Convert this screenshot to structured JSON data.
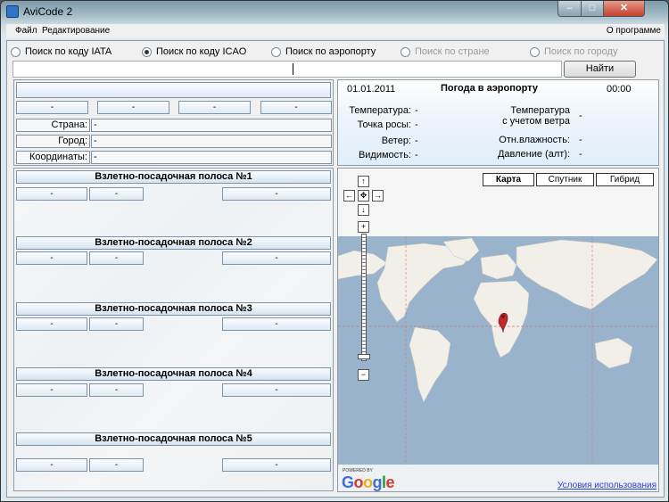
{
  "window": {
    "title": "AviCode 2",
    "min": "–",
    "max": "□",
    "close": "✕"
  },
  "menu": {
    "file": "Файл",
    "edit": "Редактирование",
    "about": "О программе"
  },
  "search_modes": [
    {
      "label": "Поиск по коду IATA",
      "state": "normal"
    },
    {
      "label": "Поиск по коду ICAO",
      "state": "selected"
    },
    {
      "label": "Поиск по аэропорту",
      "state": "normal"
    },
    {
      "label": "Поиск по стране",
      "state": "disabled"
    },
    {
      "label": "Поиск по городу",
      "state": "disabled"
    }
  ],
  "search": {
    "value": "",
    "placeholder": ""
  },
  "find_label": "Найти",
  "airport": {
    "name": "",
    "codes": [
      "-",
      "-",
      "-",
      "-"
    ],
    "country_label": "Страна:",
    "country_value": "-",
    "city_label": "Город:",
    "city_value": "-",
    "coords_label": "Координаты:",
    "coords_value": "-"
  },
  "runways": [
    {
      "title": "Взлетно-посадочная полоса №1",
      "values": [
        "-",
        "-",
        "-"
      ]
    },
    {
      "title": "Взлетно-посадочная полоса №2",
      "values": [
        "-",
        "-",
        "-"
      ]
    },
    {
      "title": "Взлетно-посадочная полоса №3",
      "values": [
        "-",
        "-",
        "-"
      ]
    },
    {
      "title": "Взлетно-посадочная полоса №4",
      "values": [
        "-",
        "-",
        "-"
      ]
    },
    {
      "title": "Взлетно-посадочная полоса №5",
      "values": [
        "-",
        "-",
        "-"
      ]
    }
  ],
  "weather": {
    "date": "01.01.2011",
    "title": "Погода в аэропорту",
    "time": "00:00",
    "temperature_label": "Температура:",
    "temperature": "-",
    "dewpoint_label": "Точка росы:",
    "dewpoint": "-",
    "wind_label": "Ветер:",
    "wind": "-",
    "visibility_label": "Видимость:",
    "visibility": "-",
    "feels_label_1": "Температура",
    "feels_label_2": "с учетом ветра",
    "feels": "-",
    "humidity_label": "Отн.влажность:",
    "humidity": "-",
    "pressure_label": "Давление (алт):",
    "pressure": "-"
  },
  "map": {
    "tabs": [
      "Карта",
      "Спутник",
      "Гибрид"
    ],
    "active_tab": "Карта",
    "nav": {
      "up": "↑",
      "down": "↓",
      "left": "←",
      "right": "→",
      "center": "✥",
      "zoom_in": "+",
      "zoom_out": "−"
    },
    "powered_by": "POWERED BY",
    "logo": "Google",
    "terms": "Условия использования",
    "colors": {
      "water": "#99b3cc",
      "land": "#f2efe9",
      "marker": "#c0292b"
    }
  }
}
